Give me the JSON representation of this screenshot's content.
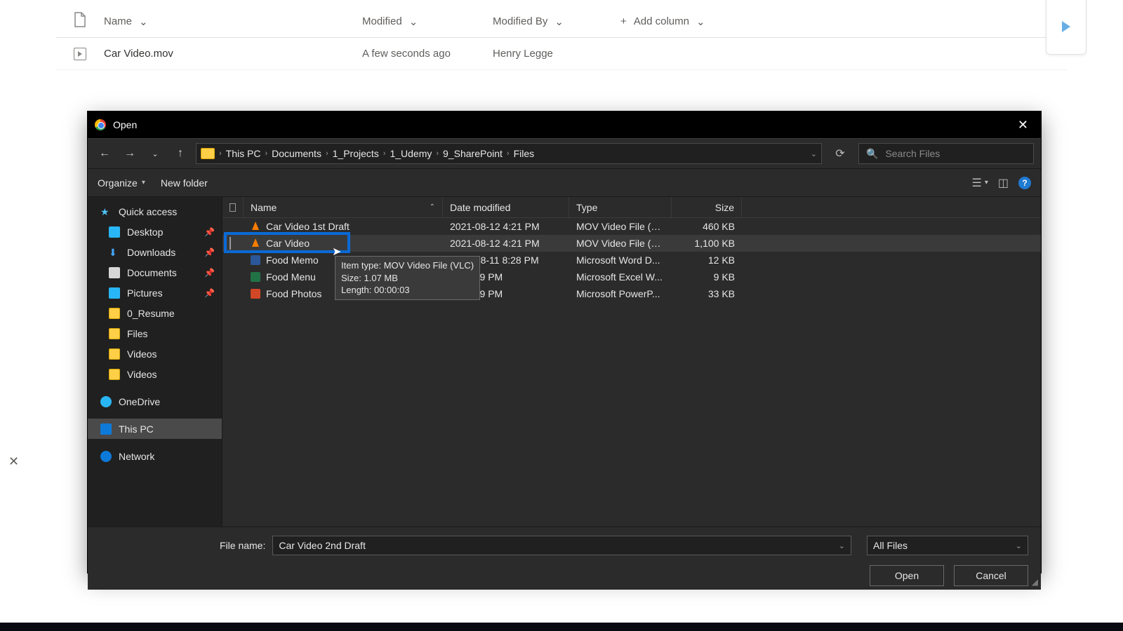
{
  "sharepoint": {
    "columns": {
      "name": "Name",
      "modified": "Modified",
      "modifiedBy": "Modified By",
      "add": "Add column"
    },
    "row": {
      "filename": "Car Video.mov",
      "modified": "A few seconds ago",
      "modifiedBy": "Henry Legge"
    }
  },
  "dialog": {
    "title": "Open",
    "breadcrumb": [
      "This PC",
      "Documents",
      "1_Projects",
      "1_Udemy",
      "9_SharePoint",
      "Files"
    ],
    "searchPlaceholder": "Search Files",
    "organize": "Organize",
    "newFolder": "New folder",
    "sidebar": {
      "quick": "Quick access",
      "items": [
        "Desktop",
        "Downloads",
        "Documents",
        "Pictures",
        "0_Resume",
        "Files",
        "Videos",
        "Videos"
      ],
      "onedrive": "OneDrive",
      "thispc": "This PC",
      "network": "Network"
    },
    "columns": {
      "name": "Name",
      "date": "Date modified",
      "type": "Type",
      "size": "Size"
    },
    "files": [
      {
        "name": "Car Video 1st Draft",
        "date": "2021-08-12 4:21 PM",
        "type": "MOV Video File (V...",
        "size": "460 KB",
        "icon": "vlc"
      },
      {
        "name": "Car Video",
        "date": "2021-08-12 4:21 PM",
        "type": "MOV Video File (V...",
        "size": "1,100 KB",
        "icon": "vlc",
        "selected": true
      },
      {
        "name": "Food Memo",
        "date": "2021-08-11 8:28 PM",
        "type": "Microsoft Word D...",
        "size": "12 KB",
        "icon": "doc"
      },
      {
        "name": "Food Menu",
        "date": "-11 8:29 PM",
        "type": "Microsoft Excel W...",
        "size": "9 KB",
        "icon": "xls"
      },
      {
        "name": "Food Photos",
        "date": "-11 8:29 PM",
        "type": "Microsoft PowerP...",
        "size": "33 KB",
        "icon": "ppt"
      }
    ],
    "tooltip": {
      "line1": "Item type: MOV Video File (VLC)",
      "line2": "Size: 1.07 MB",
      "line3": "Length: 00:00:03"
    },
    "filenameLabel": "File name:",
    "filenameValue": "Car Video 2nd Draft",
    "filterValue": "All Files",
    "openBtn": "Open",
    "cancelBtn": "Cancel"
  }
}
